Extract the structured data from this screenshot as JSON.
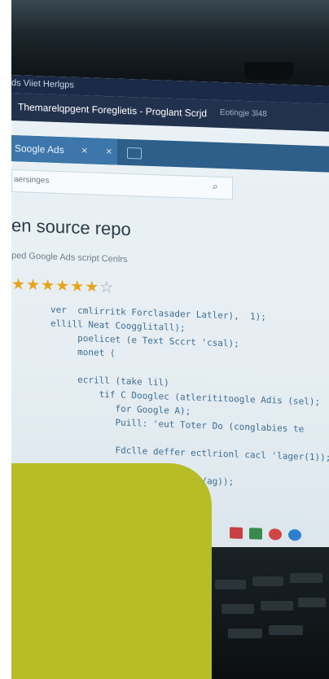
{
  "os_bar": {
    "title": "ds Viiet Herlgps"
  },
  "browser": {
    "address_bar": "Themarelqpgent Foreglietis - Proglant Scrjd",
    "address_extra": "Eotingje 3l48",
    "tab_label": "Soogle Ads",
    "tab_close": "×",
    "tab_close_2": "×",
    "search_placeholder": "aersinges",
    "search_icon": "⌕"
  },
  "page": {
    "title": "en source repo",
    "subtitle": "ped Google Ads script Cenlrs",
    "rating": {
      "filled": 6,
      "total": 7
    }
  },
  "code_lines": [
    "ver  cmlirritk Forclasader Latler),  1);",
    "ellill Neat Coogglitall);",
    "     poelicet (e Text Sccrt 'csal);",
    "     monet (",
    "",
    "     ecrill (take lil)",
    "         tif C Dooglec (atlerititoogle Adis (sel);",
    "            for Google A);",
    "            Puill: 'eut Toter Do (conglabies te",
    "",
    "            Fdclle deffer ectlrionl cacl 'lager(1));",
    "",
    "                           c/ag));"
  ],
  "colors": {
    "accent": "#b7bd26",
    "tab_blue": "#3c76aa",
    "code_text": "#3f6d93",
    "star": "#e8a318"
  }
}
